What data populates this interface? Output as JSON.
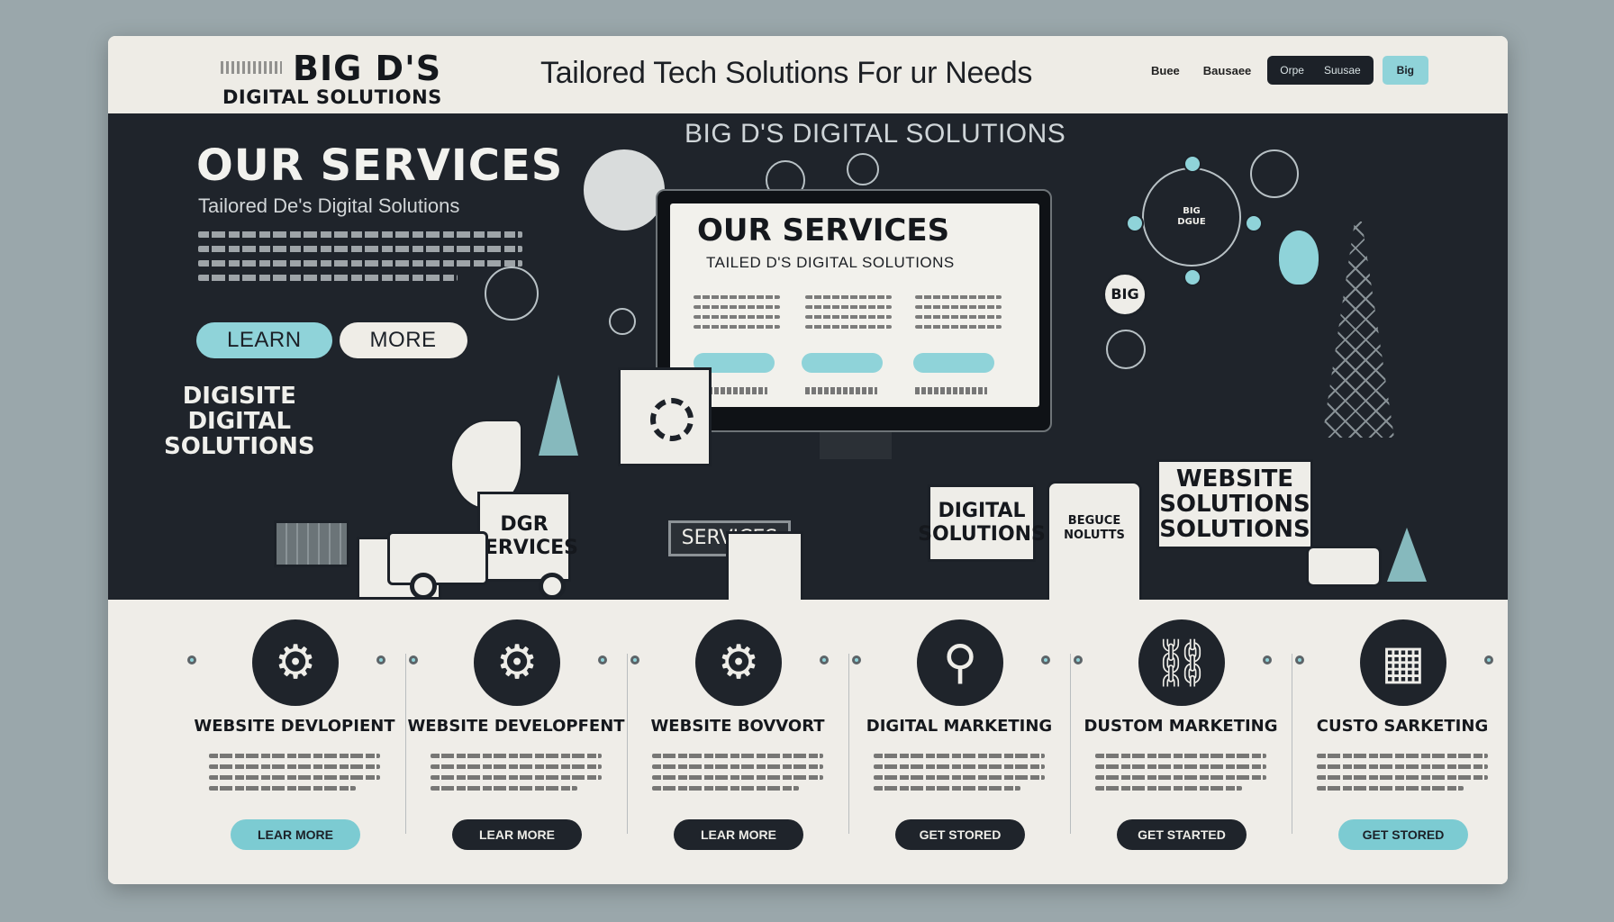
{
  "header": {
    "logo_line1": "BIG D'S",
    "logo_line2": "DIGITAL SOLUTIONS",
    "tagline": "Tailored Tech Solutions For ur Needs",
    "nav_links": [
      "Buee",
      "Bausaee"
    ],
    "nav_pill_items": [
      "Orpe",
      "Suusae"
    ],
    "nav_cta": "Big"
  },
  "hero": {
    "background_title": "BIG D'S DIGITAL SOLUTIONS",
    "title": "OUR SERVICES",
    "subtitle": "Tailored De's Digital Solutions",
    "buttons": {
      "learn": "LEARN",
      "more": "MORE"
    },
    "side_label": "DIGISITE\nDIGITAL\nSOLUTIONS",
    "monitor_title": "OUR SERVICES",
    "monitor_subtitle": "TAILED D'S DIGITAL SOLUTIONS",
    "signs": {
      "dgr_services": "DGR\nSERVICES",
      "services": "SERVICES",
      "digital_solutions": "DIGITAL\nSOLUTIONS",
      "phone": "BEGUCE\nNOLUTTS",
      "website_solutions": "WEBSITE\nSOLUTIONS\nSOLUTIONS",
      "badge": "BIG",
      "hub": "BIG\nDGUE"
    }
  },
  "services": [
    {
      "title": "WEBSITE DEVLOPIENT",
      "button": "LEAR MORE",
      "button_style": "teal",
      "icon": "gear-icon"
    },
    {
      "title": "WEBSITE DEVELOPFENT",
      "button": "LEAR MORE",
      "button_style": "dark",
      "icon": "gear-icon"
    },
    {
      "title": "WEBSITE BOVVORT",
      "button": "LEAR MORE",
      "button_style": "dark",
      "icon": "gear-icon"
    },
    {
      "title": "DIGITAL MARKETING",
      "button": "GET STORED",
      "button_style": "dark",
      "icon": "magnifier-icon"
    },
    {
      "title": "DUSTOM MARKETING",
      "button": "GET STARTED",
      "button_style": "dark",
      "icon": "chain-icon"
    },
    {
      "title": "CUSTO SARKETING",
      "button": "GET STORED",
      "button_style": "teal",
      "icon": "document-icon"
    }
  ],
  "colors": {
    "accent": "#8fd3d9",
    "dark": "#1f242b",
    "paper": "#efede8"
  }
}
